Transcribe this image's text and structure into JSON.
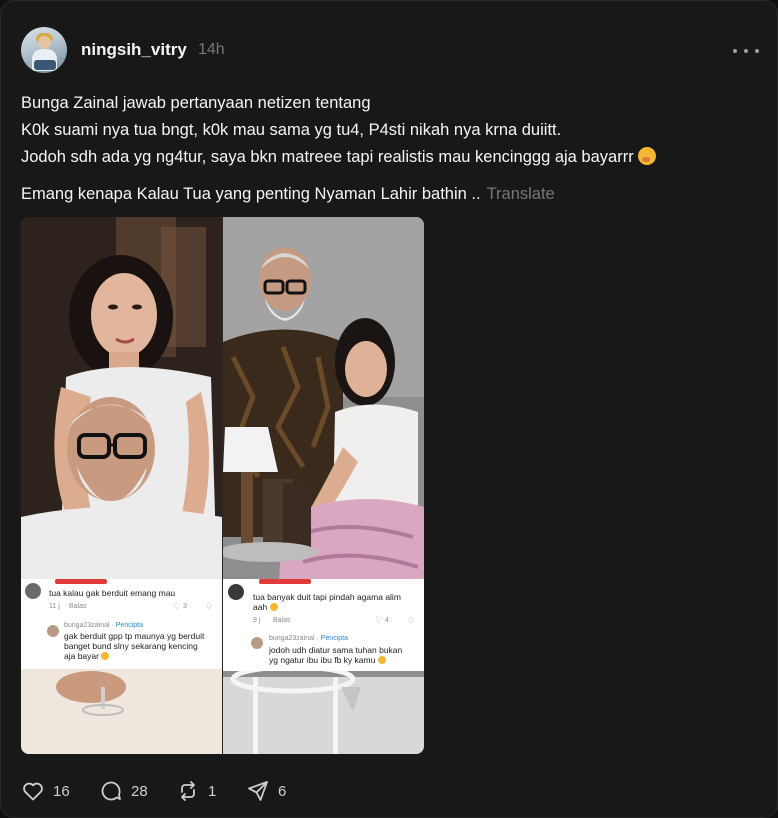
{
  "post": {
    "username": "ningsih_vitry",
    "time": "14h",
    "lines": [
      "Bunga Zainal jawab pertanyaan netizen tentang",
      "K0k suami nya tua bngt, k0k mau sama yg tu4, P4sti nikah nya krna duiitt.",
      "Jodoh sdh ada yg ng4tur, saya bkn matreee tapi realistis mau kencinggg aja bayarrr",
      "Emang kenapa Kalau Tua yang penting Nyaman Lahir bathin .."
    ],
    "translate_label": "Translate"
  },
  "image": {
    "left_comment": {
      "text": "tua kalau gak berduit emang mau",
      "time": "11 j",
      "reply_label": "Balas",
      "likes": "3",
      "reply_author": "bunga23zainal",
      "reply_badge": "Pencipta",
      "reply_text_1": "gak berduit gpp tp maunya yg berduit",
      "reply_text_2": "banget bund slny sekarang kencing",
      "reply_text_3": "aja bayar"
    },
    "right_comment": {
      "text_1": "tua banyak duit tapi pindah agama alim",
      "text_2": "aah",
      "time": "9 j",
      "reply_label": "Balas",
      "likes": "4",
      "reply_author": "bunga23zainal",
      "reply_badge": "Pencipta",
      "reply_text_1": "jodoh udh diatur sama tuhan bukan",
      "reply_text_2": "yg ngatur ibu ibu fb ky kamu"
    }
  },
  "actions": {
    "likes": "16",
    "replies": "28",
    "reposts": "1",
    "shares": "6"
  },
  "colors": {
    "background": "#181818",
    "text": "#f3f5f7",
    "muted": "#777777",
    "creator_badge": "#2e8bd6"
  },
  "icons": [
    "heart-icon",
    "comment-icon",
    "repost-icon",
    "share-icon",
    "more-icon"
  ]
}
